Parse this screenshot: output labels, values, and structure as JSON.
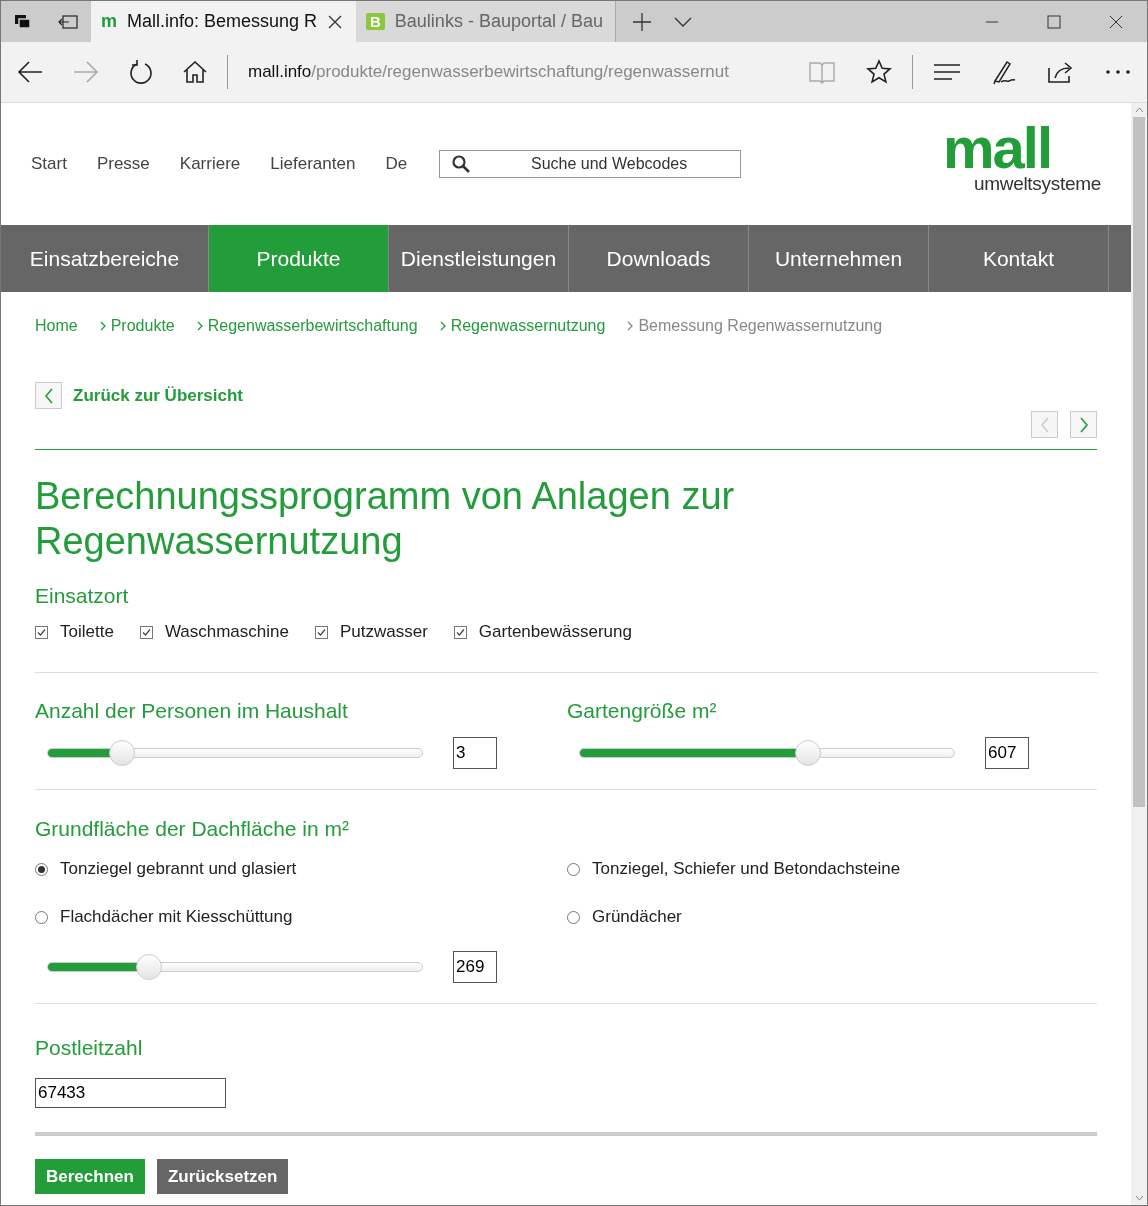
{
  "browser": {
    "tabs": [
      {
        "title": "Mall.info: Bemessung R",
        "selected": true,
        "icon": "m"
      },
      {
        "title": "Baulinks - Bauportal / Bau",
        "selected": false,
        "icon": "B"
      }
    ],
    "address": {
      "host": "mall.info",
      "path": "/produkte/regenwasserbewirtschaftung/regenwassernut"
    }
  },
  "header": {
    "links": [
      "Start",
      "Presse",
      "Karriere",
      "Lieferanten",
      "De"
    ],
    "search": {
      "placeholder": "Suche und Webcodes"
    },
    "logo": {
      "word": "mall",
      "tagline": "umweltsysteme"
    }
  },
  "nav": [
    {
      "label": "Einsatzbereiche",
      "selected": false
    },
    {
      "label": "Produkte",
      "selected": true
    },
    {
      "label": "Dienstleistungen",
      "selected": false
    },
    {
      "label": "Downloads",
      "selected": false
    },
    {
      "label": "Unternehmen",
      "selected": false
    },
    {
      "label": "Kontakt",
      "selected": false
    }
  ],
  "breadcrumb": [
    {
      "label": "Home",
      "current": false
    },
    {
      "label": "Produkte",
      "current": false
    },
    {
      "label": "Regenwasserbewirtschaftung",
      "current": false
    },
    {
      "label": "Regenwassernutzung",
      "current": false
    },
    {
      "label": "Bemessung Regenwassernutzung",
      "current": true
    }
  ],
  "back_link": "Zurück zur Übersicht",
  "title": "Berechnungssprogramm von Anlagen zur Regenwassernutzung",
  "einsatzort": {
    "heading": "Einsatzort",
    "options": [
      {
        "label": "Toilette",
        "checked": true
      },
      {
        "label": "Waschmaschine",
        "checked": true
      },
      {
        "label": "Putzwasser",
        "checked": true
      },
      {
        "label": "Gartenbewässerung",
        "checked": true
      }
    ]
  },
  "sliders": [
    {
      "heading": "Anzahl der Personen im Haushalt",
      "level": 0.2,
      "value": "3"
    },
    {
      "heading": "Gartengröße m²",
      "level": 0.61,
      "value": "607"
    }
  ],
  "roof": {
    "heading": "Grundfläche der Dachfläche in m²",
    "options": [
      {
        "label": "Tonziegel gebrannt und glasiert",
        "selected": true
      },
      {
        "label": "Tonziegel, Schiefer und Betondachsteine",
        "selected": false
      },
      {
        "label": "Flachdächer mit Kiesschüttung",
        "selected": false
      },
      {
        "label": "Gründächer",
        "selected": false
      }
    ],
    "level": 0.27,
    "value": "269"
  },
  "postcode": {
    "heading": "Postleitzahl",
    "value": "67433"
  },
  "buttons": [
    {
      "label": "Berechnen",
      "kind": "primary"
    },
    {
      "label": "Zurücksetzen",
      "kind": "secondary"
    }
  ]
}
